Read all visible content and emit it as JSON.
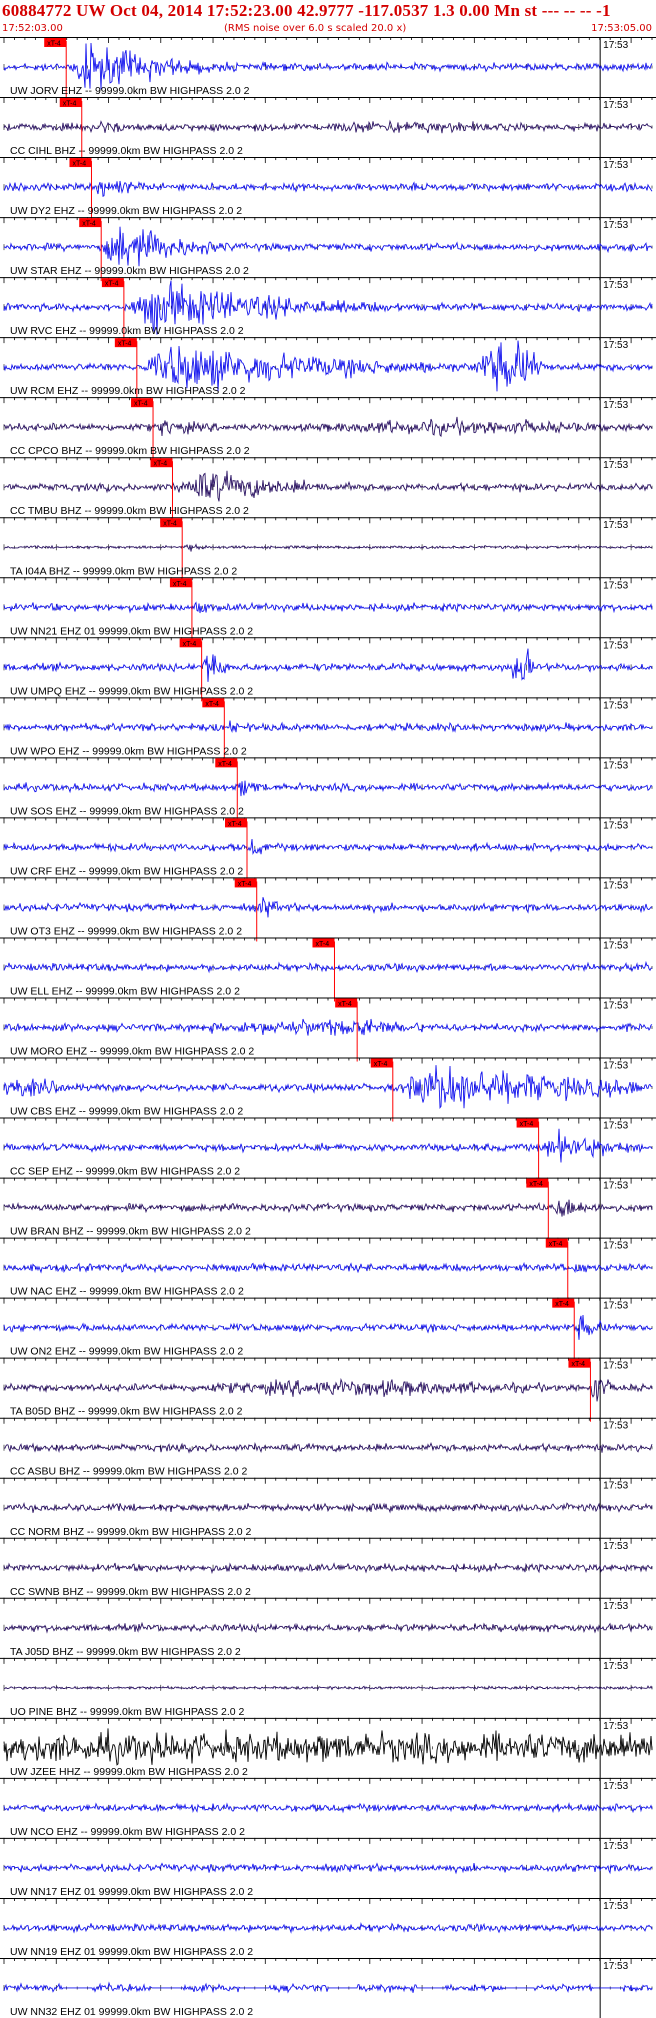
{
  "header": {
    "title": "60884772 UW Oct 04, 2014 17:52:23.00   42.9777 -117.0537  1.3 0.00 Mn st --- -- --   -1",
    "start_time": "17:52:03.00",
    "end_time": "17:53:05.00",
    "rms_note": "(RMS noise over 6.0 s scaled 20.0 x)"
  },
  "colors": {
    "wave_blue": "#1414ee",
    "wave_navy": "#2a1262",
    "wave_black": "#000000",
    "pick": "#ff0000",
    "grid": "#000000",
    "text": "#000000",
    "title": "#d40000"
  },
  "minute_label": "17:53",
  "pick_label": "xT-4",
  "traces": [
    {
      "label": "UW JORV EHZ -- 99999.0km BW  HIGHPASS  2.0  2",
      "color": "blue",
      "pick": 0.096,
      "event_amp": 1.0,
      "event_len": 0.2
    },
    {
      "label": "CC CIHL BHZ -- 99999.0km BW  HIGHPASS  2.0  2",
      "color": "navy",
      "pick": 0.12,
      "event_amp": 0.35,
      "event_len": 0.12,
      "late": [
        0.62,
        0.25,
        0.2
      ]
    },
    {
      "label": "UW DY2 EHZ -- 99999.0km BW  HIGHPASS  2.0  2",
      "color": "blue",
      "pick": 0.135,
      "event_amp": 0.4,
      "event_len": 0.12
    },
    {
      "label": "UW STAR EHZ -- 99999.0km BW  HIGHPASS  2.0  2",
      "color": "blue",
      "pick": 0.15,
      "event_amp": 1.0,
      "event_len": 0.16
    },
    {
      "label": "UW RVC EHZ -- 99999.0km BW  HIGHPASS  2.0  2",
      "color": "blue",
      "pick": 0.185,
      "event_amp": 1.0,
      "event_len": 0.33
    },
    {
      "label": "UW RCM EHZ -- 99999.0km BW  HIGHPASS  2.0  2",
      "color": "blue",
      "pick": 0.205,
      "event_amp": 1.0,
      "event_len": 0.4,
      "late": [
        0.78,
        1.0,
        0.06
      ]
    },
    {
      "label": "CC CPCO BHZ -- 99999.0km BW  HIGHPASS  2.0  2",
      "color": "navy",
      "pick": 0.23,
      "event_amp": 0.4,
      "event_len": 0.1,
      "late": [
        0.7,
        0.3,
        0.3
      ]
    },
    {
      "label": "CC TMBU BHZ -- 99999.0km BW  HIGHPASS  2.0  2",
      "color": "navy",
      "pick": 0.26,
      "event_amp": 0.7,
      "event_len": 0.25
    },
    {
      "label": "TA I04A BHZ -- 99999.0km BW  HIGHPASS  2.0  2",
      "color": "navy",
      "pick": 0.275,
      "event_amp": 0.2,
      "event_len": 0.05,
      "flat": true
    },
    {
      "label": "UW NN21 EHZ 01 99999.0km BW  HIGHPASS  2.0  2",
      "color": "blue",
      "pick": 0.29,
      "event_amp": 0.3,
      "event_len": 0.06
    },
    {
      "label": "UW UMPQ EHZ -- 99999.0km BW  HIGHPASS  2.0  2",
      "color": "blue",
      "pick": 0.305,
      "event_amp": 0.9,
      "event_len": 0.04,
      "late": [
        0.8,
        0.8,
        0.02
      ]
    },
    {
      "label": "UW WPO EHZ -- 99999.0km BW  HIGHPASS  2.0  2",
      "color": "blue",
      "pick": 0.34,
      "event_amp": 0.35,
      "event_len": 0.04
    },
    {
      "label": "UW SOS EHZ -- 99999.0km BW  HIGHPASS  2.0  2",
      "color": "blue",
      "pick": 0.36,
      "event_amp": 0.45,
      "event_len": 0.05
    },
    {
      "label": "UW CRF EHZ -- 99999.0km BW  HIGHPASS  2.0  2",
      "color": "blue",
      "pick": 0.375,
      "event_amp": 0.4,
      "event_len": 0.05
    },
    {
      "label": "UW OT3 EHZ -- 99999.0km BW  HIGHPASS  2.0  2",
      "color": "blue",
      "pick": 0.39,
      "event_amp": 0.45,
      "event_len": 0.06
    },
    {
      "label": "UW ELL EHZ -- 99999.0km BW  HIGHPASS  2.0  2",
      "color": "blue",
      "pick": 0.51,
      "event_amp": 0.2,
      "event_len": 0.04
    },
    {
      "label": "UW MORO EHZ -- 99999.0km BW  HIGHPASS  2.0  2",
      "color": "blue",
      "pick": 0.545,
      "event_amp": 0.6,
      "event_len": 0.04,
      "pre": [
        0.06,
        0.35,
        0.34
      ]
    },
    {
      "label": "UW CBS EHZ -- 99999.0km BW  HIGHPASS  2.0  2",
      "color": "blue",
      "pick": 0.6,
      "event_amp": 1.0,
      "event_len": 0.4,
      "pre": [
        0.56,
        0.4,
        0.1
      ]
    },
    {
      "label": "CC SEP EHZ -- 99999.0km BW  HIGHPASS  2.0  2",
      "color": "blue",
      "pick": 0.825,
      "event_amp": 0.6,
      "event_len": 0.17
    },
    {
      "label": "UW BRAN BHZ -- 99999.0km BW  HIGHPASS  2.0  2",
      "color": "navy",
      "pick": 0.84,
      "event_amp": 0.5,
      "event_len": 0.1
    },
    {
      "label": "UW NAC EHZ -- 99999.0km BW  HIGHPASS  2.0  2",
      "color": "blue",
      "pick": 0.87,
      "event_amp": 0.3,
      "event_len": 0.06
    },
    {
      "label": "UW ON2 EHZ -- 99999.0km BW  HIGHPASS  2.0  2",
      "color": "blue",
      "pick": 0.88,
      "event_amp": 0.55,
      "event_len": 0.06
    },
    {
      "label": "TA B05D BHZ -- 99999.0km BW  HIGHPASS  2.0  2",
      "color": "navy",
      "pick": 0.905,
      "event_amp": 0.9,
      "event_len": 0.03,
      "pre": [
        0.35,
        0.35,
        0.5
      ]
    },
    {
      "label": "CC ASBU BHZ -- 99999.0km BW  HIGHPASS  2.0  2",
      "color": "navy",
      "pick": null
    },
    {
      "label": "CC NORM BHZ -- 99999.0km BW  HIGHPASS  2.0  2",
      "color": "navy",
      "pick": null
    },
    {
      "label": "CC SWNB BHZ -- 99999.0km BW  HIGHPASS  2.0  2",
      "color": "navy",
      "pick": null
    },
    {
      "label": "TA J05D BHZ -- 99999.0km BW  HIGHPASS  2.0  2",
      "color": "navy",
      "pick": null
    },
    {
      "label": "UO PINE BHZ -- 99999.0km BW  HIGHPASS  2.0  2",
      "color": "navy",
      "pick": null,
      "flat": true
    },
    {
      "label": "UW JZEE HHZ -- 99999.0km BW  HIGHPASS  2.0  2",
      "color": "black",
      "pick": null,
      "noise": 0.55
    },
    {
      "label": "UW NCO EHZ -- 99999.0km BW  HIGHPASS  2.0  2",
      "color": "blue",
      "pick": null
    },
    {
      "label": "UW NN17 EHZ 01 99999.0km BW  HIGHPASS  2.0  2",
      "color": "blue",
      "pick": null
    },
    {
      "label": "UW NN19 EHZ 01 99999.0km BW  HIGHPASS  2.0  2",
      "color": "blue",
      "pick": null
    },
    {
      "label": "UW NN32 EHZ 01 99999.0km BW  HIGHPASS  2.0  2",
      "color": "blue",
      "pick": null,
      "gappy": true
    }
  ]
}
